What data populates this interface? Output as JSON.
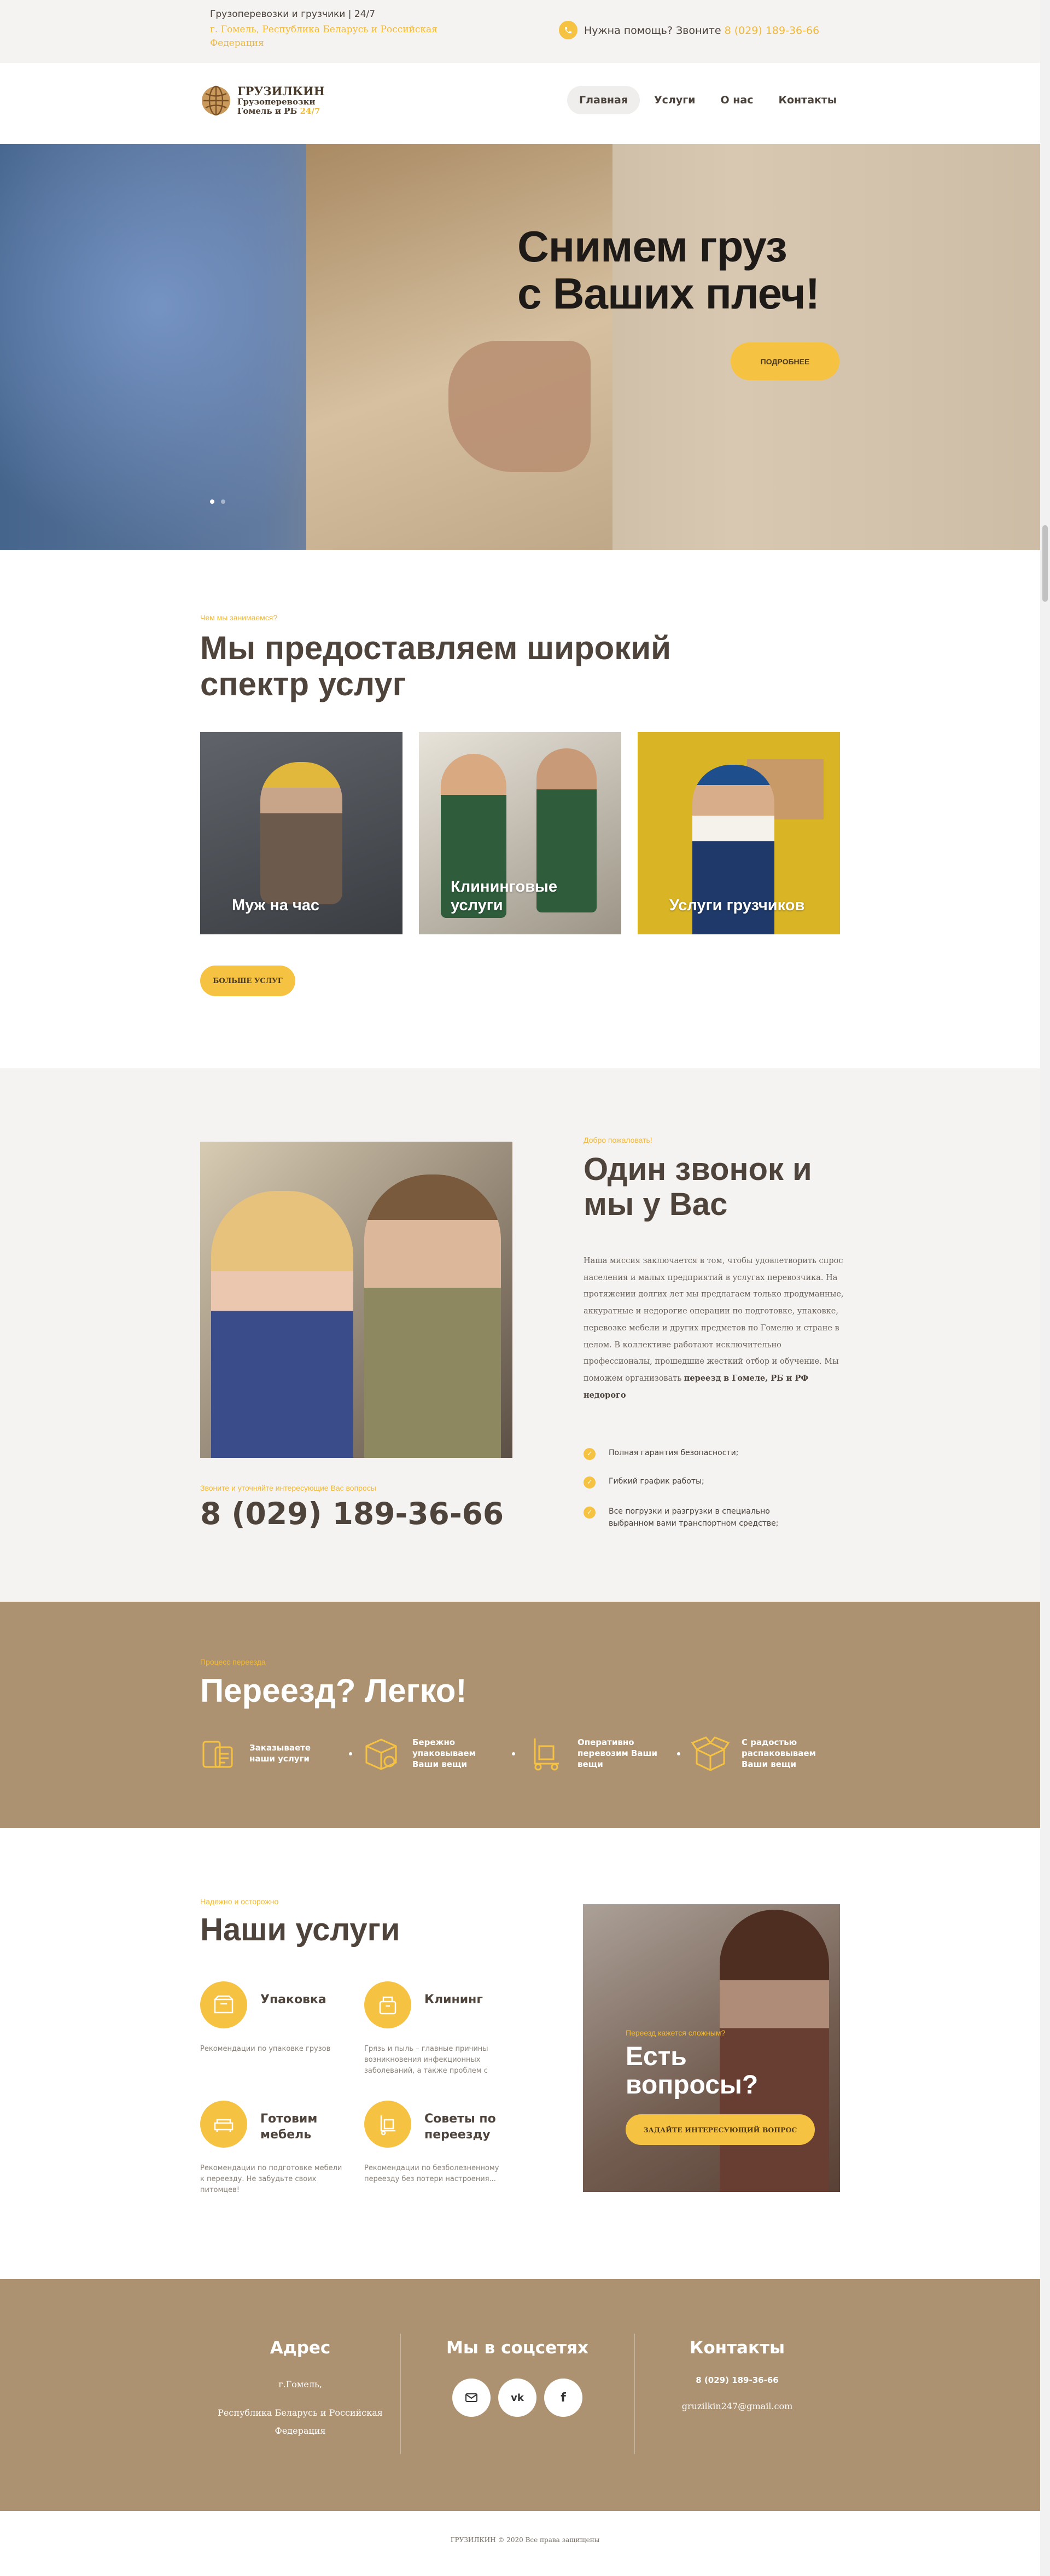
{
  "topbar": {
    "line1": "Грузоперевозки и грузчики | 24/7",
    "line2": "г. Гомель, Республика Беларусь и Российская Федерация",
    "help_label": "Нужна помощь? Звоните",
    "phone": "8 (029) 189-36-66"
  },
  "logo": {
    "name": "ГРУЗИЛКИН",
    "sub1": "Грузоперевозки",
    "sub2": "Гомель и РБ",
    "sub2_accent": "24/7"
  },
  "nav": [
    {
      "label": "Главная",
      "active": true
    },
    {
      "label": "Услуги"
    },
    {
      "label": "О нас"
    },
    {
      "label": "Контакты"
    }
  ],
  "hero": {
    "title1": "Снимем груз",
    "title2": "с Ваших плеч!",
    "button": "ПОДРОБНЕЕ"
  },
  "services_intro": {
    "kicker": "Чем мы занимаемся?",
    "title": "Мы предоставляем широкий спектр услуг",
    "cards": [
      {
        "label": "Муж на час"
      },
      {
        "label": "Клининговые услуги"
      },
      {
        "label": "Услуги грузчиков"
      }
    ],
    "more_button": "БОЛЬШЕ УСЛУГ"
  },
  "about": {
    "kicker": "Добро пожаловать!",
    "title": "Один звонок и мы у Вас",
    "text": "Наша миссия заключается в том, чтобы удовлетворить спрос населения и малых предприятий в услугах перевозчика. На протяжении долгих лет мы предлагаем только продуманные, аккуратные и недорогие операции по подготовке, упаковке, перевозке мебели и других предметов по Гомелю и стране в целом. В коллективе работают исключительно профессионалы, прошедшие жесткий отбор и обучение. Мы поможем организовать",
    "text_bold": "переезд в Гомеле, РБ и РФ недорого",
    "call_kicker": "Звоните и уточняйте интересующие Вас вопросы",
    "phone": "8 (029) 189-36-66",
    "bullets": [
      "Полная гарантия безопасности;",
      "Гибкий график работы;",
      "Все погрузки и разгрузки в специально выбранном вами транспортном средстве;"
    ]
  },
  "process": {
    "kicker": "Процесс переезда",
    "title": "Переезд? Легко!",
    "steps": [
      {
        "label": "Заказываете наши услуги",
        "icon": "phone-order-icon"
      },
      {
        "label": "Бережно упаковываем Ваши вещи",
        "icon": "box-pack-icon"
      },
      {
        "label": "Оперативно перевозим Ваши вещи",
        "icon": "cart-icon"
      },
      {
        "label": "С радостью распаковываем Ваши вещи",
        "icon": "open-box-icon"
      }
    ]
  },
  "our_services": {
    "kicker": "Надежно и осторожно",
    "title": "Наши услуги",
    "items": [
      {
        "title": "Упаковка",
        "desc": "Рекомендации по упаковке грузов",
        "icon": "package-icon"
      },
      {
        "title": "Клининг",
        "desc": "Грязь и пыль – главные причины возникновения инфекционных заболеваний, а также проблем с",
        "icon": "cleaning-icon"
      },
      {
        "title": "Готовим мебель",
        "desc": "Рекомендации по подготовке мебели к переезду. Не забудьте своих питомцев!",
        "icon": "sofa-icon"
      },
      {
        "title": "Советы по переезду",
        "desc": "Рекомендации по безболезненному переезду без потери настроения...",
        "icon": "dolly-icon"
      }
    ],
    "cta_kicker": "Переезд кажется сложным?",
    "cta_title": "Есть вопросы?",
    "cta_button": "ЗАДАЙТЕ ИНТЕРЕСУЮЩИЙ ВОПРОС"
  },
  "footer": {
    "address_title": "Адрес",
    "address_city": "г.Гомель,",
    "address_country": "Республика Беларусь и Российская Федерация",
    "social_title": "Мы в соцсетях",
    "contacts_title": "Контакты",
    "phone": "8 (029) 189-36-66",
    "email": "gruzilkin247@gmail.com",
    "copyright": "ГРУЗИЛКИН © 2020 Все права защищены"
  },
  "colors": {
    "accent": "#f6c241",
    "brown": "#ad9272",
    "text": "#4f443b"
  }
}
